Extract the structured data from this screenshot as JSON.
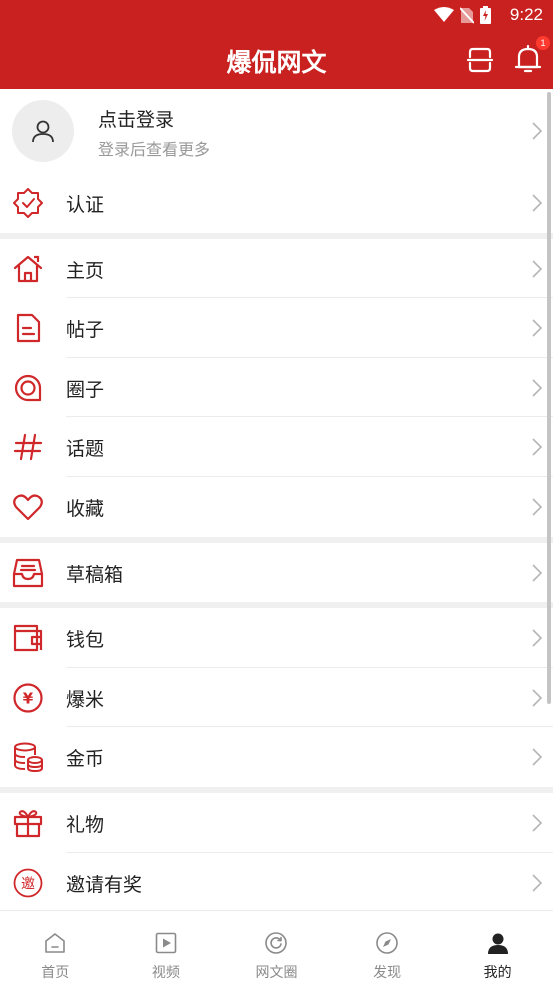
{
  "status_bar": {
    "time": "9:22"
  },
  "header": {
    "title": "爆侃网文",
    "notification_count": "1",
    "accent_color": "#c8211f"
  },
  "login": {
    "title": "点击登录",
    "subtitle": "登录后查看更多"
  },
  "menu": {
    "verify": "认证",
    "home": "主页",
    "posts": "帖子",
    "circles": "圈子",
    "topics": "话题",
    "favorites": "收藏",
    "drafts": "草稿箱",
    "wallet": "钱包",
    "baomi": "爆米",
    "coins": "金币",
    "gifts": "礼物",
    "invite": "邀请有奖"
  },
  "icons": {
    "invite_glyph": "邀",
    "coin_glyph": "¥"
  },
  "tabs": [
    {
      "label": "首页",
      "icon": "home-icon"
    },
    {
      "label": "视频",
      "icon": "video-icon"
    },
    {
      "label": "网文圈",
      "icon": "circle-refresh-icon"
    },
    {
      "label": "发现",
      "icon": "compass-icon"
    },
    {
      "label": "我的",
      "icon": "user-icon",
      "active": true
    }
  ]
}
